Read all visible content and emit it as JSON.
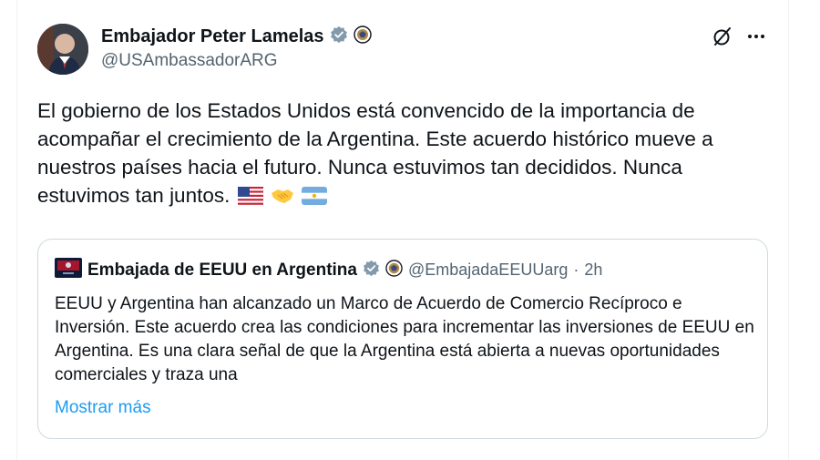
{
  "post": {
    "author_name": "Embajador Peter Lamelas",
    "author_handle": "@USAmbassadorARG",
    "text": "El gobierno de los Estados Unidos está convencido de la importancia de acompañar el crecimiento de la Argentina. Este acuerdo histórico mueve a nuestros países hacia el futuro. Nunca estuvimos tan decididos. Nunca estuvimos tan juntos.",
    "emojis": [
      "us-flag",
      "handshake",
      "argentina-flag"
    ]
  },
  "quote": {
    "author_name": "Embajada de EEUU en Argentina",
    "author_handle": "@EmbajadaEEUUarg",
    "separator": "·",
    "time": "2h",
    "text": "EEUU y Argentina han alcanzado un Marco de Acuerdo de Comercio Recíproco e Inversión. Este acuerdo crea las condiciones para incrementar las inversiones de EEUU en Argentina. Es una clara señal de que la Argentina está abierta a nuevas oportunidades comerciales y traza una",
    "show_more": "Mostrar más"
  },
  "colors": {
    "verified_badge": "#829aab",
    "link": "#1d9bf0",
    "secondary_text": "#536471"
  }
}
